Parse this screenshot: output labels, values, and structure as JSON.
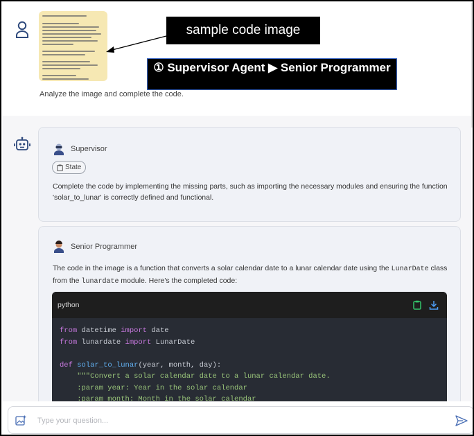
{
  "annotations": {
    "sample_label": "sample code image",
    "agent_label": "① Supervisor Agent ▶ Senior Programmer"
  },
  "user_message": {
    "text": "Analyze the image and complete the code."
  },
  "supervisor": {
    "name": "Supervisor",
    "state_label": "State",
    "message": "Complete the code by implementing the missing parts, such as importing the necessary modules and ensuring the function 'solar_to_lunar' is correctly defined and functional."
  },
  "programmer": {
    "name": "Senior Programmer",
    "message_part1": "The code in the image is a function that converts a solar calendar date to a lunar calendar date using the ",
    "message_code1": "LunarDate",
    "message_part2": " class from the ",
    "message_code2": "lunardate",
    "message_part3": " module. Here's the completed code:",
    "code_lang": "python",
    "code_lines": [
      "from datetime import date",
      "from lunardate import LunarDate",
      "",
      "def solar_to_lunar(year, month, day):",
      "    \"\"\"Convert a solar calendar date to a lunar calendar date.",
      "    :param year: Year in the solar calendar",
      "    :param month: Month in the solar calendar"
    ]
  },
  "input": {
    "placeholder": "Type your question..."
  },
  "icons": [
    "user-icon",
    "bot-icon",
    "supervisor-avatar-icon",
    "programmer-avatar-icon",
    "clipboard-icon",
    "download-icon",
    "image-upload-icon",
    "send-icon"
  ]
}
